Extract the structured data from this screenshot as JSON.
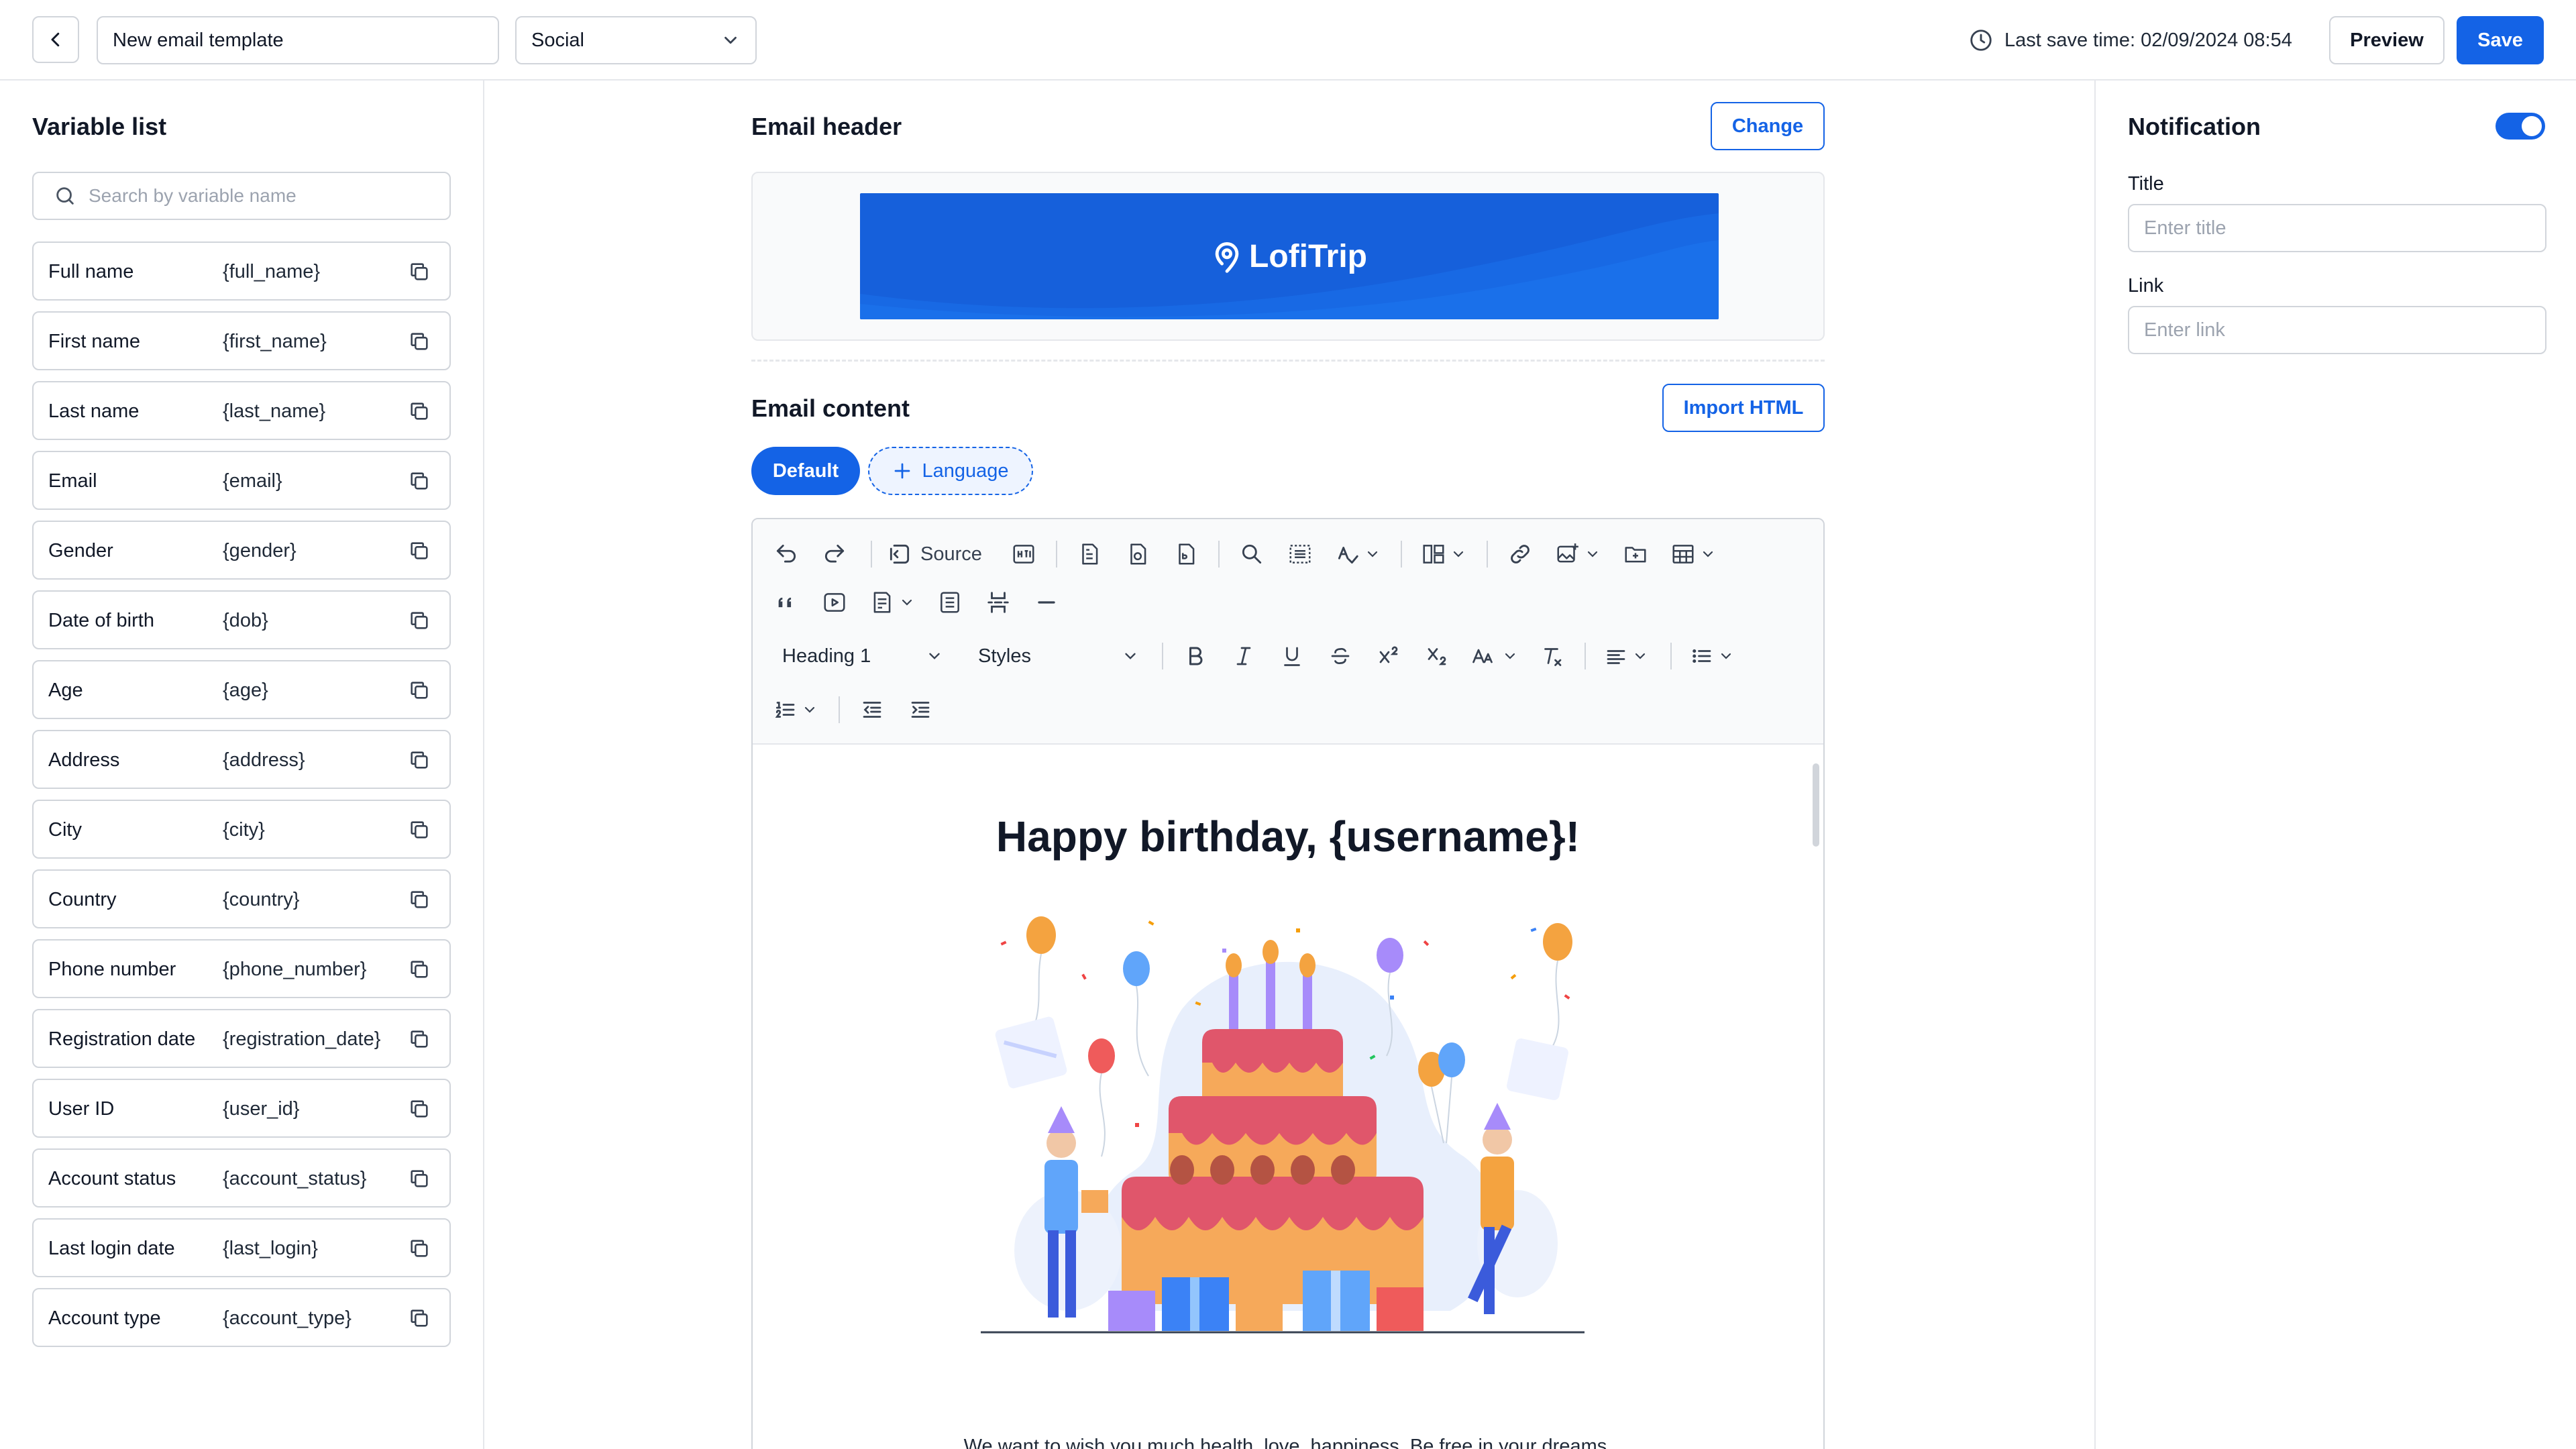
{
  "topbar": {
    "template_name": "New email template",
    "category": "Social",
    "save_time": "Last save time: 02/09/2024 08:54",
    "preview_label": "Preview",
    "save_label": "Save"
  },
  "sidebar": {
    "title": "Variable list",
    "search_placeholder": "Search by variable name",
    "variables": [
      {
        "name": "Full name",
        "key": "{full_name}"
      },
      {
        "name": "First name",
        "key": "{first_name}"
      },
      {
        "name": "Last name",
        "key": "{last_name}"
      },
      {
        "name": "Email",
        "key": "{email}"
      },
      {
        "name": "Gender",
        "key": "{gender}"
      },
      {
        "name": "Date of birth",
        "key": "{dob}"
      },
      {
        "name": "Age",
        "key": "{age}"
      },
      {
        "name": "Address",
        "key": "{address}"
      },
      {
        "name": "City",
        "key": "{city}"
      },
      {
        "name": "Country",
        "key": "{country}"
      },
      {
        "name": "Phone number",
        "key": "{phone_number}"
      },
      {
        "name": "Registration date",
        "key": "{registration_date}"
      },
      {
        "name": "User ID",
        "key": "{user_id}"
      },
      {
        "name": "Account status",
        "key": "{account_status}"
      },
      {
        "name": "Last login date",
        "key": "{last_login}"
      },
      {
        "name": "Account type",
        "key": "{account_type}"
      }
    ]
  },
  "main": {
    "header_title": "Email header",
    "change_label": "Change",
    "brand_name": "LofiTrip",
    "content_title": "Email content",
    "import_label": "Import HTML",
    "tab_default": "Default",
    "tab_language": "Language",
    "toolbar": {
      "source_label": "Source",
      "heading_select": "Heading 1",
      "styles_select": "Styles"
    },
    "email": {
      "heading": "Happy birthday, {username}!",
      "body": "We want to wish you much health, love, happiness. Be free in your dreams."
    }
  },
  "notification": {
    "title": "Notification",
    "enabled": true,
    "title_label": "Title",
    "title_placeholder": "Enter title",
    "link_label": "Link",
    "link_placeholder": "Enter link"
  },
  "colors": {
    "primary": "#1463e6",
    "border": "#d1d5db",
    "banner": "#1660db"
  }
}
